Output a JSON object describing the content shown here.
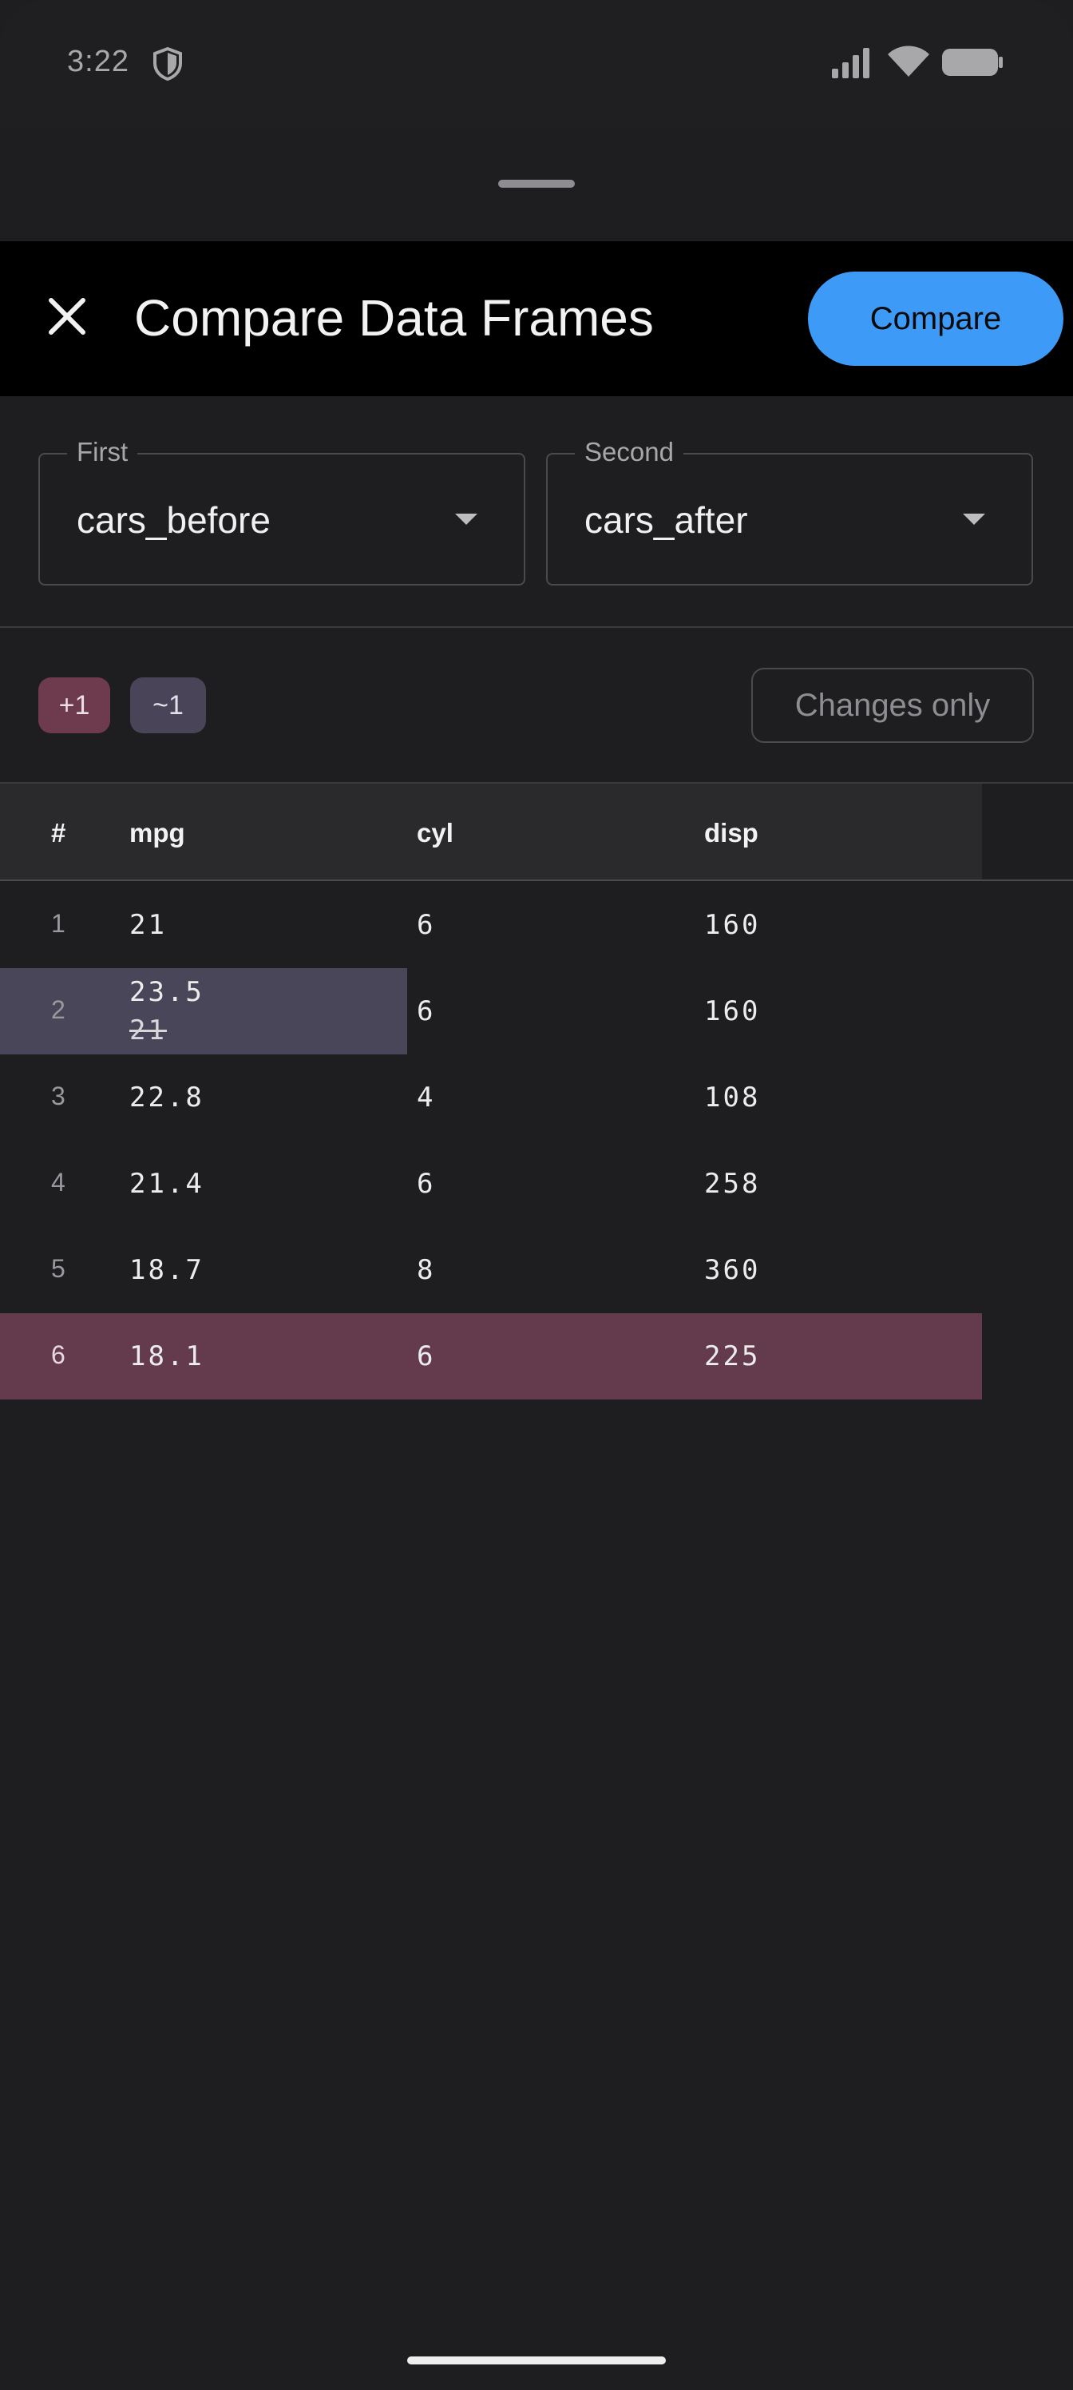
{
  "status_bar": {
    "time": "3:22"
  },
  "header": {
    "title": "Compare Data Frames",
    "compare_label": "Compare"
  },
  "selects": {
    "first": {
      "label": "First",
      "value": "cars_before"
    },
    "second": {
      "label": "Second",
      "value": "cars_after"
    }
  },
  "summary": {
    "added_badge": "+1",
    "changed_badge": "~1",
    "changes_only_label": "Changes only"
  },
  "table": {
    "columns": [
      "#",
      "mpg",
      "cyl",
      "disp"
    ],
    "rows": [
      {
        "index": "1",
        "mpg": "21",
        "cyl": "6",
        "disp": "160"
      },
      {
        "index": "2",
        "mpg": "23.5",
        "mpg_old": "21",
        "cyl": "6",
        "disp": "160"
      },
      {
        "index": "3",
        "mpg": "22.8",
        "cyl": "4",
        "disp": "108"
      },
      {
        "index": "4",
        "mpg": "21.4",
        "cyl": "6",
        "disp": "258"
      },
      {
        "index": "5",
        "mpg": "18.7",
        "cyl": "8",
        "disp": "360"
      },
      {
        "index": "6",
        "mpg": "18.1",
        "cyl": "6",
        "disp": "225"
      }
    ]
  },
  "colors": {
    "accent": "#3d9af6",
    "added_row": "#643b4c",
    "changed_cell": "#4a4659"
  }
}
